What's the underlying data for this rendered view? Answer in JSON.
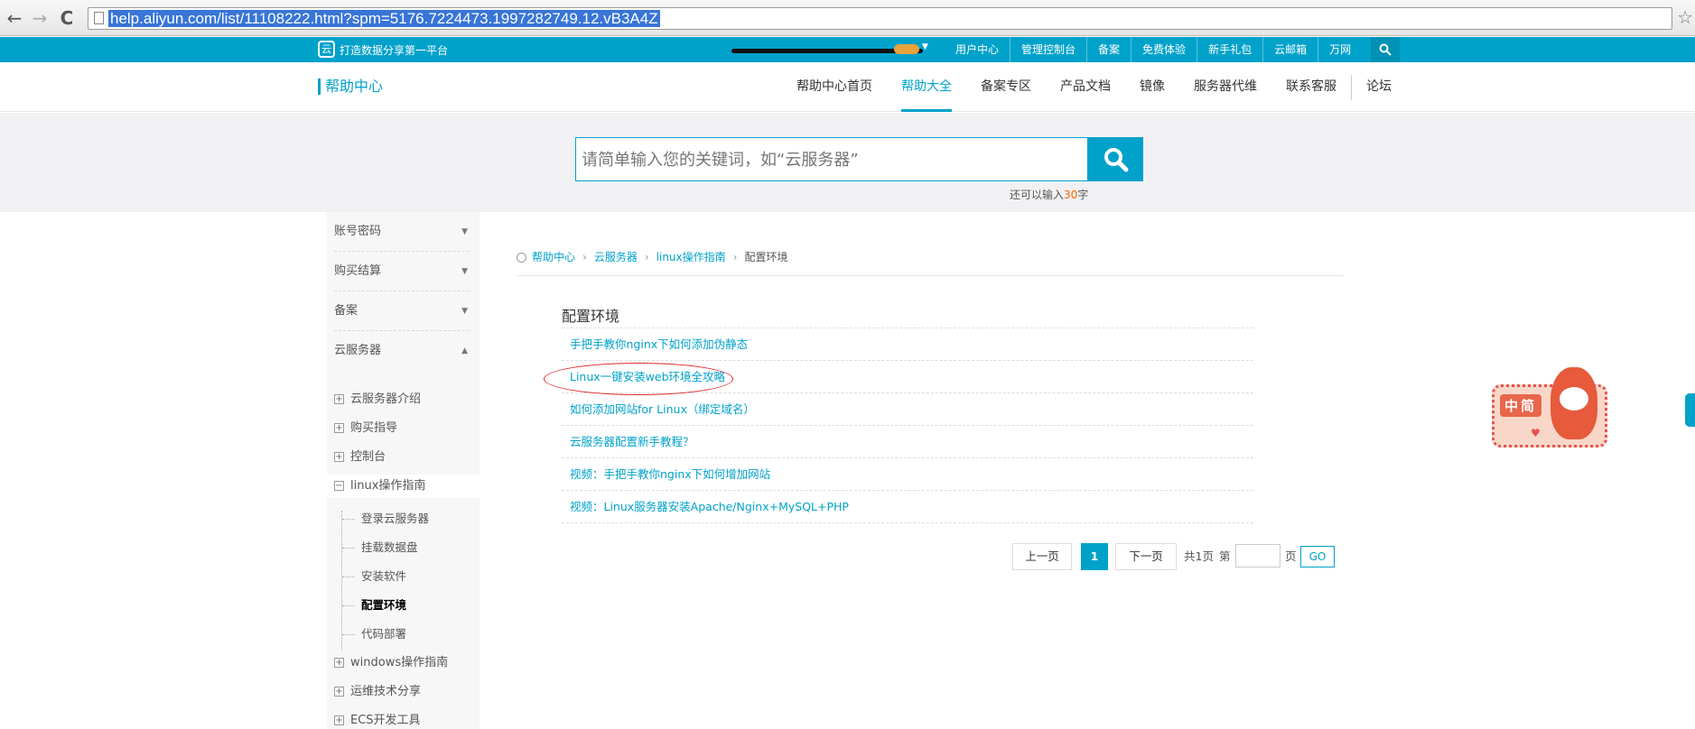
{
  "browser": {
    "back": "←",
    "forward": "→",
    "reload": "C",
    "url": "help.aliyun.com/list/11108222.html?spm=5176.7224473.1997282749.12.vB3A4Z",
    "star": "☆"
  },
  "topbar": {
    "logo_glyph": "云",
    "slogan": "打造数据分享第一平台",
    "user_caret": "▼",
    "links": [
      "用户中心",
      "管理控制台",
      "备案",
      "免费体验",
      "新手礼包",
      "云邮箱",
      "万网"
    ]
  },
  "header": {
    "brand": "帮助中心",
    "nav": [
      "帮助中心首页",
      "帮助大全",
      "备案专区",
      "产品文档",
      "镜像",
      "服务器代维",
      "联系客服"
    ],
    "forum": "论坛",
    "active_nav": "帮助大全"
  },
  "search": {
    "placeholder": "请简单输入您的关键词，如“云服务器”",
    "hint_prefix": "还可以输入",
    "hint_count": "30",
    "hint_suffix": "字"
  },
  "sidebar": {
    "sections": [
      "账号密码",
      "购买结算",
      "备案",
      "云服务器"
    ],
    "caret_down": "▼",
    "caret_up": "▲",
    "items": [
      "云服务器介绍",
      "购买指导",
      "控制台",
      "linux操作指南"
    ],
    "subitems": [
      "登录云服务器",
      "挂载数据盘",
      "安装软件",
      "配置环境",
      "代码部署"
    ],
    "items_after": [
      "windows操作指南",
      "运维技术分享",
      "ECS开发工具"
    ],
    "current_sub": "配置环境"
  },
  "breadcrumb": {
    "items": [
      "帮助中心",
      "云服务器",
      "linux操作指南"
    ],
    "current": "配置环境",
    "separator": "›"
  },
  "content": {
    "title": "配置环境",
    "articles": [
      "手把手教你nginx下如何添加伪静态",
      "Linux一键安装web环境全攻略",
      "如何添加网站for Linux（绑定域名）",
      "云服务器配置新手教程？",
      "视频：手把手教你nginx下如何增加网站",
      "视频：Linux服务器安装Apache/Nginx+MySQL+PHP"
    ],
    "highlighted_article_index": 1
  },
  "pagination": {
    "prev": "上一页",
    "current": "1",
    "next": "下一页",
    "total": "共1页",
    "goto_prefix": "第",
    "goto_suffix": "页",
    "go": "GO"
  },
  "mascot": {
    "label": "中简",
    "heart": "♥"
  },
  "colors": {
    "accent": "#00a2ca",
    "highlight_ring": "#e0272b",
    "hint_number": "#ff6600"
  }
}
